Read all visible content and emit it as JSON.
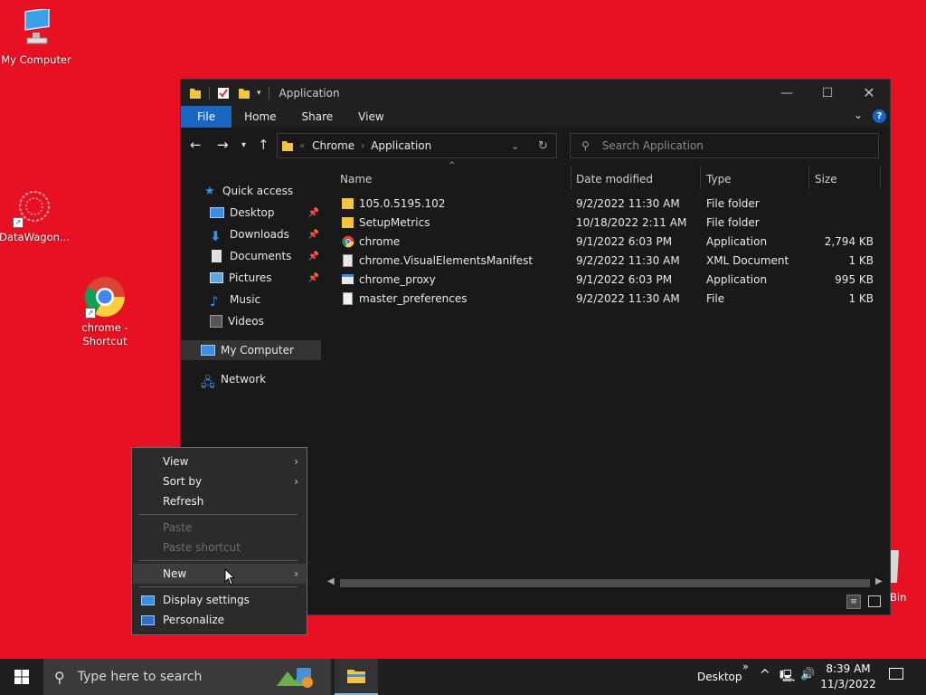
{
  "desktop": {
    "icons": [
      {
        "label": "My Computer"
      },
      {
        "label": "DataWagon..."
      },
      {
        "label": "chrome - Shortcut"
      }
    ],
    "recycle_bin_label": "Bin"
  },
  "explorer": {
    "title": "Application",
    "ribbon_tabs": [
      "File",
      "Home",
      "Share",
      "View"
    ],
    "breadcrumb": [
      "Chrome",
      "Application"
    ],
    "search_placeholder": "Search Application",
    "nav": {
      "quick_access": "Quick access",
      "items": [
        "Desktop",
        "Downloads",
        "Documents",
        "Pictures",
        "Music",
        "Videos"
      ],
      "my_computer": "My Computer",
      "network": "Network"
    },
    "columns": [
      "Name",
      "Date modified",
      "Type",
      "Size"
    ],
    "files": [
      {
        "name": "105.0.5195.102",
        "date": "9/2/2022 11:30 AM",
        "type": "File folder",
        "size": "",
        "icon": "folder-icon"
      },
      {
        "name": "SetupMetrics",
        "date": "10/18/2022 2:11 AM",
        "type": "File folder",
        "size": "",
        "icon": "folder-icon"
      },
      {
        "name": "chrome",
        "date": "9/1/2022 6:03 PM",
        "type": "Application",
        "size": "2,794 KB",
        "icon": "chrome-icon"
      },
      {
        "name": "chrome.VisualElementsManifest",
        "date": "9/2/2022 11:30 AM",
        "type": "XML Document",
        "size": "1 KB",
        "icon": "xml-file-icon"
      },
      {
        "name": "chrome_proxy",
        "date": "9/1/2022 6:03 PM",
        "type": "Application",
        "size": "995 KB",
        "icon": "app-icon"
      },
      {
        "name": "master_preferences",
        "date": "9/2/2022 11:30 AM",
        "type": "File",
        "size": "1 KB",
        "icon": "file-icon"
      }
    ]
  },
  "context_menu": {
    "view": "View",
    "sort_by": "Sort by",
    "refresh": "Refresh",
    "paste": "Paste",
    "paste_shortcut": "Paste shortcut",
    "new": "New",
    "display_settings": "Display settings",
    "personalize": "Personalize"
  },
  "taskbar": {
    "search_placeholder": "Type here to search",
    "desktop_label": "Desktop",
    "time": "8:39 AM",
    "date": "11/3/2022"
  },
  "colors": {
    "desktop_bg": "#e81123",
    "accent": "#1a65c4",
    "folder": "#f5c542"
  }
}
